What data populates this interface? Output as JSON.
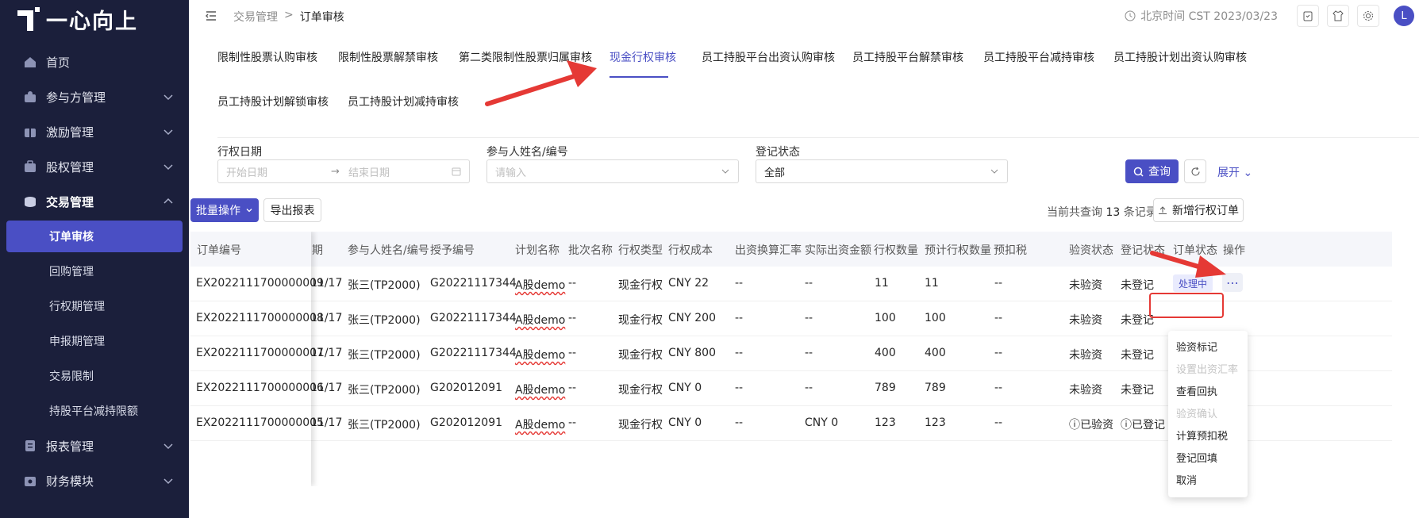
{
  "app": {
    "logo_text": "一心向上"
  },
  "sidebar": {
    "items": [
      {
        "label": "首页",
        "icon": "home-icon"
      },
      {
        "label": "参与方管理",
        "icon": "users-icon"
      },
      {
        "label": "激励管理",
        "icon": "gift-icon"
      },
      {
        "label": "股权管理",
        "icon": "briefcase-icon"
      },
      {
        "label": "交易管理",
        "icon": "coins-icon"
      }
    ],
    "sub_items": [
      "订单审核",
      "回购管理",
      "行权期管理",
      "申报期管理",
      "交易限制",
      "持股平台减持限额"
    ],
    "bottom_items": [
      {
        "label": "报表管理",
        "icon": "report-icon"
      },
      {
        "label": "财务模块",
        "icon": "finance-icon"
      }
    ]
  },
  "header": {
    "breadcrumb": [
      "交易管理",
      "订单审核"
    ],
    "clock_text": "北京时间 CST 2023/03/23",
    "avatar_letter": "L"
  },
  "tabs": [
    "限制性股票认购审核",
    "限制性股票解禁审核",
    "第二类限制性股票归属审核",
    "现金行权审核",
    "员工持股平台出资认购审核",
    "员工持股平台解禁审核",
    "员工持股平台减持审核",
    "员工持股计划出资认购审核",
    "员工持股计划解锁审核",
    "员工持股计划减持审核"
  ],
  "filters": {
    "date_label": "行权日期",
    "start_placeholder": "开始日期",
    "end_placeholder": "结束日期",
    "person_label": "参与人姓名/编号",
    "person_placeholder": "请输入",
    "status_label": "登记状态",
    "status_value": "全部",
    "query_button": "查询",
    "expand_link": "展开"
  },
  "toolbar": {
    "batch_button": "批量操作",
    "export_button": "导出报表",
    "summary_prefix": "当前共查询",
    "summary_count": "13",
    "summary_suffix": "条记录",
    "new_button": "新增行权订单"
  },
  "table": {
    "columns": [
      "订单编号",
      "期",
      "参与人姓名/编号",
      "授予编号",
      "计划名称",
      "批次名称",
      "行权类型",
      "行权成本",
      "出资换算汇率",
      "实际出资金额",
      "行权数量",
      "预计行权数量",
      "预扣税",
      "验资状态",
      "登记状态",
      "订单状态",
      "操作"
    ],
    "rows": [
      [
        "EX2022111700000009",
        "11/17",
        "张三(TP2000)",
        "G20221117344",
        "A股demo",
        "--",
        "现金行权",
        "CNY 22",
        "--",
        "--",
        "11",
        "11",
        "--",
        "未验资",
        "未登记",
        "处理中"
      ],
      [
        "EX2022111700000008",
        "11/17",
        "张三(TP2000)",
        "G20221117344",
        "A股demo",
        "--",
        "现金行权",
        "CNY 200",
        "--",
        "--",
        "100",
        "100",
        "--",
        "未验资",
        "未登记",
        ""
      ],
      [
        "EX2022111700000007",
        "11/17",
        "张三(TP2000)",
        "G20221117344",
        "A股demo",
        "--",
        "现金行权",
        "CNY 800",
        "--",
        "--",
        "400",
        "400",
        "--",
        "未验资",
        "未登记",
        ""
      ],
      [
        "EX2022111700000006",
        "11/17",
        "张三(TP2000)",
        "G202012091",
        "A股demo",
        "--",
        "现金行权",
        "CNY 0",
        "--",
        "--",
        "789",
        "789",
        "--",
        "未验资",
        "未登记",
        ""
      ],
      [
        "EX2022111700000005",
        "11/17",
        "张三(TP2000)",
        "G202012091",
        "A股demo",
        "--",
        "现金行权",
        "CNY 0",
        "--",
        "CNY 0",
        "123",
        "123",
        "--",
        "已验资",
        "已登记",
        ""
      ]
    ]
  },
  "dropdown": {
    "items": [
      {
        "label": "验资标记",
        "disabled": false
      },
      {
        "label": "设置出资汇率",
        "disabled": true
      },
      {
        "label": "查看回执",
        "disabled": false
      },
      {
        "label": "验资确认",
        "disabled": true
      },
      {
        "label": "计算预扣税",
        "disabled": false
      },
      {
        "label": "登记回填",
        "disabled": false
      },
      {
        "label": "取消",
        "disabled": false
      }
    ]
  },
  "colors": {
    "accent": "#4a4fc4",
    "sidebar_bg": "#1b1f3b",
    "annotation_red": "#e53935"
  }
}
